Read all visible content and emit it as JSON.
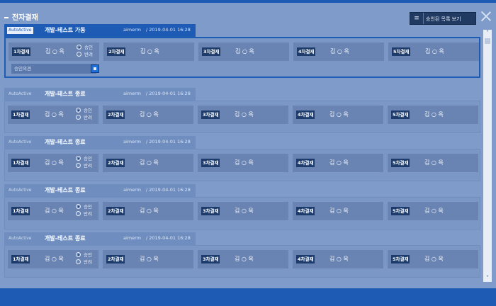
{
  "header": {
    "title": "전자결재",
    "list_button_icon": "≡",
    "list_button_label": "승인된 목록 보기"
  },
  "cards": [
    {
      "auto_label": "AutoActive",
      "title": "개발-테스트 가동",
      "user": "aimerm",
      "date": "/ 2019-04-01 16:28",
      "active": true,
      "opinion_placeholder": "승인의견",
      "steps": [
        {
          "label": "1차결재",
          "name": "김 ○ 옥"
        },
        {
          "label": "2차결재",
          "name": "김 ○ 옥"
        },
        {
          "label": "3차결재",
          "name": "김 ○ 옥"
        },
        {
          "label": "4차결재",
          "name": "김 ○ 옥"
        },
        {
          "label": "5차결재",
          "name": "김 ○ 옥"
        }
      ],
      "radio_approve": "승인",
      "radio_reject": "반려"
    },
    {
      "auto_label": "AutoActive",
      "title": "개발-테스트 종료",
      "user": "aimerm",
      "date": "/ 2019-04-01 16:28",
      "steps": [
        {
          "label": "1차결재",
          "name": "김 ○ 옥"
        },
        {
          "label": "2차결재",
          "name": "김 ○ 옥"
        },
        {
          "label": "3차결재",
          "name": "김 ○ 옥"
        },
        {
          "label": "4차결재",
          "name": "김 ○ 옥"
        },
        {
          "label": "5차결재",
          "name": "김 ○ 옥"
        }
      ],
      "radio_approve": "승인",
      "radio_reject": "반려"
    },
    {
      "auto_label": "AutoActive",
      "title": "개발-테스트 종료",
      "user": "aimerm",
      "date": "/ 2019-04-01 16:28",
      "steps": [
        {
          "label": "1차결재",
          "name": "김 ○ 옥"
        },
        {
          "label": "2차결재",
          "name": "김 ○ 옥"
        },
        {
          "label": "3차결재",
          "name": "김 ○ 옥"
        },
        {
          "label": "4차결재",
          "name": "김 ○ 옥"
        },
        {
          "label": "5차결재",
          "name": "김 ○ 옥"
        }
      ],
      "radio_approve": "승인",
      "radio_reject": "반려"
    },
    {
      "auto_label": "AutoActive",
      "title": "개발-테스트 종료",
      "user": "aimerm",
      "date": "/ 2019-04-01 16:28",
      "steps": [
        {
          "label": "1차결재",
          "name": "김 ○ 옥"
        },
        {
          "label": "2차결재",
          "name": "김 ○ 옥"
        },
        {
          "label": "3차결재",
          "name": "김 ○ 옥"
        },
        {
          "label": "4차결재",
          "name": "김 ○ 옥"
        },
        {
          "label": "5차결재",
          "name": "김 ○ 옥"
        }
      ],
      "radio_approve": "승인",
      "radio_reject": "반려"
    },
    {
      "auto_label": "AutoActive",
      "title": "개발-테스트 종료",
      "user": "aimerm",
      "date": "/ 2019-04-01 16:28",
      "steps": [
        {
          "label": "1차결재",
          "name": "김 ○ 옥"
        },
        {
          "label": "2차결재",
          "name": "김 ○ 옥"
        },
        {
          "label": "3차결재",
          "name": "김 ○ 옥"
        },
        {
          "label": "4차결재",
          "name": "김 ○ 옥"
        },
        {
          "label": "5차결재",
          "name": "김 ○ 옥"
        }
      ],
      "radio_approve": "승인",
      "radio_reject": "반려"
    }
  ],
  "scrollbar": {
    "up_icon": "˄",
    "down_icon": "˅"
  }
}
